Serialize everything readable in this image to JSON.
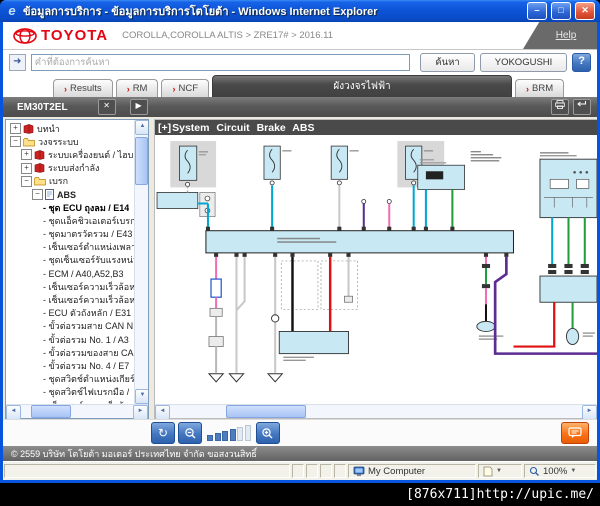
{
  "window": {
    "title": "ข้อมูลการบริการ - ข้อมูลการบริการโตโยต้า - Windows Internet Explorer",
    "header": {
      "brand": "TOYOTA",
      "breadcrumb": "COROLLA,COROLLA ALTIS > ZRE17# > 2016.11",
      "help_label": "Help"
    },
    "search": {
      "placeholder": "คำที่ต้องการค้นหา",
      "search_button": "ค้นหา",
      "yokogushi_button": "YOKOGUSHI",
      "help_button": "?"
    },
    "tabs": [
      {
        "label": "Results",
        "active": false
      },
      {
        "label": "RM",
        "active": false
      },
      {
        "label": "NCF",
        "active": false
      },
      {
        "label": "ผังวงจรไฟฟ้า",
        "active": true
      },
      {
        "label": "BRM",
        "active": false
      }
    ],
    "doc_toolbar": {
      "doc_code": "EM30T2EL"
    },
    "tree": {
      "items": [
        {
          "type": "book",
          "exp": "+",
          "lvl": 0,
          "label": "บทนำ",
          "sel": false
        },
        {
          "type": "folder",
          "exp": "-",
          "lvl": 0,
          "label": "วงจรระบบ",
          "sel": false
        },
        {
          "type": "book",
          "exp": "+",
          "lvl": 1,
          "label": "ระบบเครื่องยนต์ / ไฮบ",
          "sel": false
        },
        {
          "type": "book",
          "exp": "+",
          "lvl": 1,
          "label": "ระบบส่งกำลัง",
          "sel": false
        },
        {
          "type": "folder",
          "exp": "-",
          "lvl": 1,
          "label": "เบรก",
          "sel": false
        },
        {
          "type": "page",
          "exp": "-",
          "lvl": 2,
          "label": "ABS",
          "sel": false,
          "bold": true
        },
        {
          "type": "leaf",
          "lvl": 3,
          "label": "ชุด ECU ถุงลม / E14",
          "sel": true
        },
        {
          "type": "leaf",
          "lvl": 3,
          "label": "ชุดแอ็คชิวเอเตอร์เบรก",
          "sel": false
        },
        {
          "type": "leaf",
          "lvl": 3,
          "label": "ชุดมาตรวัดรวม / E43",
          "sel": false
        },
        {
          "type": "leaf",
          "lvl": 3,
          "label": "เซ็นเซอร์ตำแหน่งเพลา",
          "sel": false
        },
        {
          "type": "leaf",
          "lvl": 3,
          "label": "ชุดเซ็นเซอร์รับแรงหน่ว",
          "sel": false
        },
        {
          "type": "leaf",
          "lvl": 3,
          "label": "ECM / A40,A52,B3",
          "sel": false
        },
        {
          "type": "leaf",
          "lvl": 3,
          "label": "เซ็นเซอร์ความเร็วล้อห",
          "sel": false
        },
        {
          "type": "leaf",
          "lvl": 3,
          "label": "เซ็นเซอร์ความเร็วล้อห",
          "sel": false
        },
        {
          "type": "leaf",
          "lvl": 3,
          "label": "ECU ตัวถังหลัก / E31",
          "sel": false
        },
        {
          "type": "leaf",
          "lvl": 3,
          "label": "ขั้วต่อรวมสาย CAN N",
          "sel": false
        },
        {
          "type": "leaf",
          "lvl": 3,
          "label": "ขั้วต่อรวม No. 1 / A3",
          "sel": false
        },
        {
          "type": "leaf",
          "lvl": 3,
          "label": "ขั้วต่อรวมของสาย CA",
          "sel": false
        },
        {
          "type": "leaf",
          "lvl": 3,
          "label": "ขั้วต่อรวม No. 4 / E7",
          "sel": false
        },
        {
          "type": "leaf",
          "lvl": 3,
          "label": "ชุดสวิตช์ตำแหน่งเกียร์ว่",
          "sel": false
        },
        {
          "type": "leaf",
          "lvl": 3,
          "label": "ชุดสวิตช์ไฟเบรกมือ /",
          "sel": false
        },
        {
          "type": "leaf",
          "lvl": 3,
          "label": "เซ็นเซอร์ความเร็วล้อห",
          "sel": false
        }
      ]
    },
    "diagram": {
      "expand_prefix": "[+]",
      "title": "System Circuit Brake ABS"
    },
    "footer": {
      "copyright": "© 2559 บริษัท โตโยต้า มอเตอร์ ประเทศไทย จำกัด ขอสงวนสิทธิ์"
    },
    "statusbar": {
      "zone": "My Computer",
      "zoom": "100%"
    }
  },
  "icons": {
    "minimize": "–",
    "maximize": "□",
    "close": "✕",
    "tab_arrow": "›",
    "go": "➜",
    "play": "▶",
    "close_small": "✕",
    "refresh": "↻",
    "left": "◄",
    "right": "►",
    "up": "▲",
    "down": "▼",
    "ie": "e",
    "dropdown": "▼",
    "plus": "+",
    "minus": "−"
  },
  "colors": {
    "titlebar_blue": "#0855dd",
    "toyota_red": "#e30613",
    "active_tab_gray": "#4a4a4a",
    "block_fill": "#c8e8f4",
    "wire_cyan": "#00a7d0",
    "wire_green": "#1f9e3e",
    "wire_red": "#e01010",
    "wire_pink": "#f06eb4",
    "wire_purple": "#5b2c91",
    "wire_gray": "#c8c8c8",
    "button_blue": "#4377c0",
    "button_orange": "#f26b21"
  },
  "page_frame": {
    "caption": "[876x711]http://upic.me/"
  }
}
